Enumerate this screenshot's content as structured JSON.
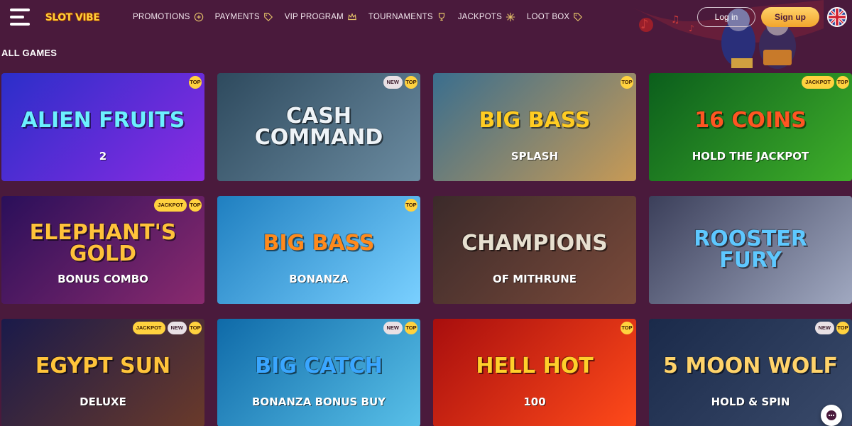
{
  "header": {
    "logo_text": "SLOT VIBE",
    "nav": [
      {
        "label": "PROMOTIONS",
        "icon": "gift-icon"
      },
      {
        "label": "PAYMENTS",
        "icon": "tag-icon"
      },
      {
        "label": "VIP PROGRAM",
        "icon": "crown-icon"
      },
      {
        "label": "TOURNAMENTS",
        "icon": "trophy-icon"
      },
      {
        "label": "JACKPOTS",
        "icon": "sparkle-icon"
      },
      {
        "label": "LOOT BOX",
        "icon": "tag-icon"
      }
    ],
    "login_label": "Log in",
    "signup_label": "Sign up",
    "language_flag": "uk-flag-icon"
  },
  "section_title": "ALL GAMES",
  "games": [
    {
      "title": "ALIEN FRUITS",
      "subtitle": "2",
      "badges": [
        "TOP"
      ],
      "colors": [
        "#2b2ec9",
        "#8a2be2"
      ],
      "title_color": "#6cf0ff"
    },
    {
      "title": "CASH COMMAND",
      "subtitle": "",
      "badges": [
        "NEW",
        "TOP"
      ],
      "colors": [
        "#2e4a5e",
        "#6b8ba0"
      ],
      "title_color": "#eef3f7"
    },
    {
      "title": "BIG BASS",
      "subtitle": "SPLASH",
      "badges": [
        "TOP"
      ],
      "colors": [
        "#3a6e8e",
        "#c89a55"
      ],
      "title_color": "#ffcc22"
    },
    {
      "title": "16 COINS",
      "subtitle": "HOLD THE JACKPOT",
      "badges": [
        "JACKPOT",
        "TOP"
      ],
      "colors": [
        "#0b5e1c",
        "#3fae2a"
      ],
      "title_color": "#ff5522"
    },
    {
      "title": "ELEPHANT'S GOLD",
      "subtitle": "BONUS COMBO",
      "badges": [
        "JACKPOT",
        "TOP"
      ],
      "colors": [
        "#2a0f5a",
        "#8a2a6e"
      ],
      "title_color": "#ffc23a"
    },
    {
      "title": "BIG BASS",
      "subtitle": "BONANZA",
      "badges": [
        "TOP"
      ],
      "colors": [
        "#1f7fc0",
        "#7ad0ff"
      ],
      "title_color": "#ff8a1c"
    },
    {
      "title": "CHAMPIONS",
      "subtitle": "OF MITHRUNE",
      "badges": [],
      "colors": [
        "#3b2a2a",
        "#7a4a3a"
      ],
      "title_color": "#e7e0d0"
    },
    {
      "title": "ROOSTER FURY",
      "subtitle": "",
      "badges": [],
      "colors": [
        "#3b3f5a",
        "#a0a8c0"
      ],
      "title_color": "#5ec8ff"
    },
    {
      "title": "EGYPT SUN",
      "subtitle": "DELUXE",
      "badges": [
        "JACKPOT",
        "NEW",
        "TOP"
      ],
      "colors": [
        "#1a1a4a",
        "#6a3a2a"
      ],
      "title_color": "#ffc43a"
    },
    {
      "title": "BIG CATCH",
      "subtitle": "BONANZA BONUS BUY",
      "badges": [
        "NEW",
        "TOP"
      ],
      "colors": [
        "#0f6aa8",
        "#59c0e8"
      ],
      "title_color": "#3aa6ff"
    },
    {
      "title": "HELL HOT",
      "subtitle": "100",
      "badges": [
        "TOP"
      ],
      "colors": [
        "#a80e0e",
        "#ff4a1a"
      ],
      "title_color": "#ffcf2a"
    },
    {
      "title": "5 MOON WOLF",
      "subtitle": "HOLD & SPIN",
      "badges": [
        "NEW",
        "TOP"
      ],
      "colors": [
        "#1a2a4a",
        "#3a4a6a"
      ],
      "title_color": "#ffd36a"
    }
  ]
}
